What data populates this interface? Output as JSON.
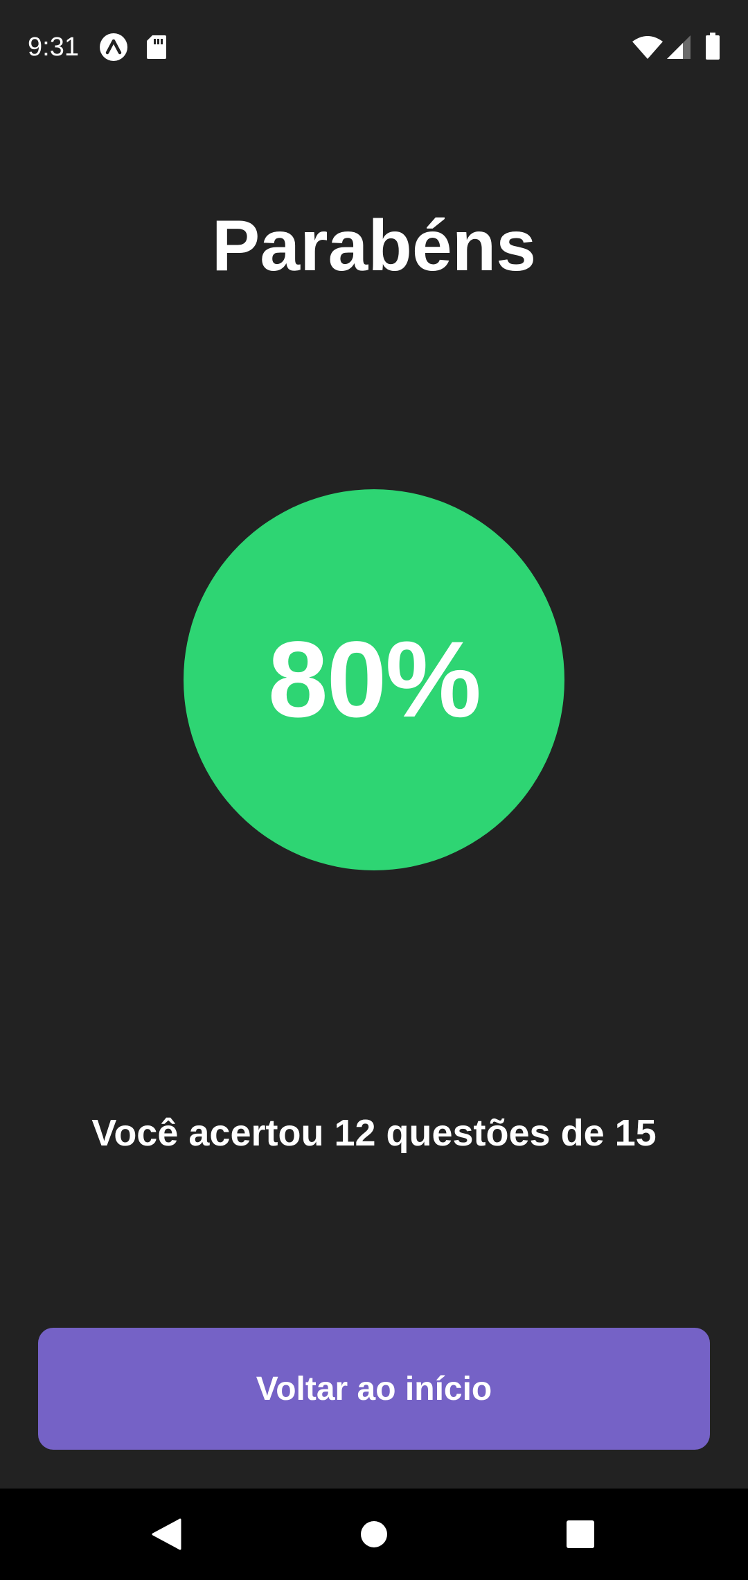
{
  "status_bar": {
    "time": "9:31",
    "icons": [
      "expo-icon",
      "sd-card-icon",
      "wifi-icon",
      "signal-icon",
      "battery-icon"
    ]
  },
  "result": {
    "title": "Parabéns",
    "score": "80%",
    "score_fraction": 0.8,
    "summary": "Você acertou 12 questões de 15",
    "score_color": "#2ED573"
  },
  "actions": {
    "back_home_label": "Voltar ao início",
    "button_color": "#7562C6"
  },
  "navigation_bar": {
    "buttons": [
      "back-icon",
      "home-icon",
      "recents-icon"
    ]
  },
  "colors": {
    "background": "#222222",
    "text": "#FFFFFF",
    "nav_background": "#000000"
  }
}
